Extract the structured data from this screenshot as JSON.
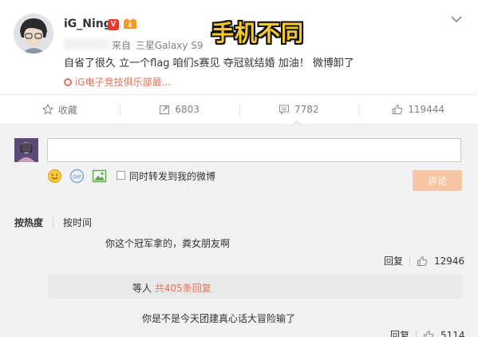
{
  "post": {
    "username": "iG_Ning",
    "verified_badge": "V",
    "source_prefix": "来自",
    "device": "三星Galaxy S9",
    "text": "自省了很久 立一个flag 咱们s赛见 夺冠就结婚 加油！ 微博卸了",
    "tag": "iG电子竞技俱乐部最...",
    "overlay_caption": "手机不同"
  },
  "actions": {
    "favorite": "收藏",
    "repost": "6803",
    "comments": "7782",
    "likes": "119444"
  },
  "composer": {
    "placeholder": "",
    "repost_label": "同时转发到我的微博",
    "submit": "评论"
  },
  "sort": {
    "hot": "按热度",
    "time": "按时间"
  },
  "comments": [
    {
      "text": "你这个冠军拿的，粪女朋友啊",
      "reply": "回复",
      "likes": "12946"
    },
    {
      "text": "你是不是今天团建真心话大冒险输了",
      "reply": "回复",
      "likes": "5114"
    }
  ],
  "sub_replies": {
    "prefix": "等人",
    "count_text": "共405条回复"
  },
  "colors": {
    "accent": "#eb7350",
    "tag": "#e1725f",
    "submit_bg": "#f7c5a3",
    "comment_bg": "#f2f2f5",
    "overlay": "#f4c92b"
  }
}
